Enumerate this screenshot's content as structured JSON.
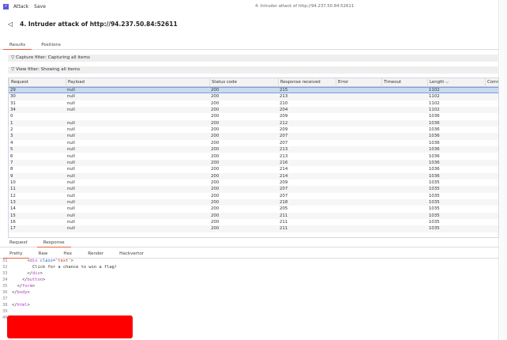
{
  "topbar": {
    "menu": [
      "Attack",
      "Save"
    ],
    "window_title": "4. Intruder attack of http://94.237.50.84:52611"
  },
  "title": "4. Intruder attack of http://94.237.50.84:52611",
  "tabs": [
    "Results",
    "Positions"
  ],
  "filters": {
    "capture": "Capture filter: Capturing all items",
    "view": "View filter: Showing all items"
  },
  "table": {
    "columns": [
      "Request",
      "Payload",
      "Status code",
      "Response received",
      "Error",
      "Timeout",
      "Length ⌵",
      "Comm"
    ],
    "rows": [
      [
        "29",
        "null",
        "200",
        "215",
        "",
        "",
        "1102"
      ],
      [
        "30",
        "null",
        "200",
        "213",
        "",
        "",
        "1102"
      ],
      [
        "31",
        "null",
        "200",
        "210",
        "",
        "",
        "1102"
      ],
      [
        "34",
        "null",
        "200",
        "204",
        "",
        "",
        "1102"
      ],
      [
        "0",
        "",
        "200",
        "209",
        "",
        "",
        "1036"
      ],
      [
        "1",
        "null",
        "200",
        "212",
        "",
        "",
        "1036"
      ],
      [
        "2",
        "null",
        "200",
        "209",
        "",
        "",
        "1036"
      ],
      [
        "3",
        "null",
        "200",
        "207",
        "",
        "",
        "1036"
      ],
      [
        "4",
        "null",
        "200",
        "207",
        "",
        "",
        "1036"
      ],
      [
        "5",
        "null",
        "200",
        "213",
        "",
        "",
        "1036"
      ],
      [
        "6",
        "null",
        "200",
        "213",
        "",
        "",
        "1036"
      ],
      [
        "7",
        "null",
        "200",
        "216",
        "",
        "",
        "1036"
      ],
      [
        "8",
        "null",
        "200",
        "214",
        "",
        "",
        "1036"
      ],
      [
        "9",
        "null",
        "200",
        "214",
        "",
        "",
        "1036"
      ],
      [
        "10",
        "null",
        "200",
        "209",
        "",
        "",
        "1035"
      ],
      [
        "11",
        "null",
        "200",
        "207",
        "",
        "",
        "1035"
      ],
      [
        "12",
        "null",
        "200",
        "207",
        "",
        "",
        "1035"
      ],
      [
        "13",
        "null",
        "200",
        "218",
        "",
        "",
        "1035"
      ],
      [
        "14",
        "null",
        "200",
        "205",
        "",
        "",
        "1035"
      ],
      [
        "15",
        "null",
        "200",
        "211",
        "",
        "",
        "1035"
      ],
      [
        "16",
        "null",
        "200",
        "211",
        "",
        "",
        "1035"
      ],
      [
        "17",
        "null",
        "200",
        "211",
        "",
        "",
        "1035"
      ]
    ]
  },
  "reqresp_tabs": [
    "Request",
    "Response"
  ],
  "view_tabs": [
    "Pretty",
    "Raw",
    "Hex",
    "Render",
    "Hackvertor"
  ],
  "code": {
    "lines": [
      "31",
      "32",
      "33",
      "34",
      "35",
      "36",
      "37",
      "38",
      "39",
      "40"
    ],
    "l31a": "      <",
    "l31tag": "div",
    "l31attr": " class=",
    "l31str": "'text'",
    "l31b": ">",
    "l32": "        Click for a chance to win a flag!",
    "l33a": "      </",
    "l33tag": "div",
    "l33b": ">",
    "l34a": "    </",
    "l34tag": "button",
    "l34b": ">",
    "l35a": "  </",
    "l35tag": "form",
    "l35b": ">",
    "l36a": "</",
    "l36tag": "body",
    "l36b": ">",
    "l38a": "</",
    "l38tag": "html",
    "l38b": ">"
  }
}
